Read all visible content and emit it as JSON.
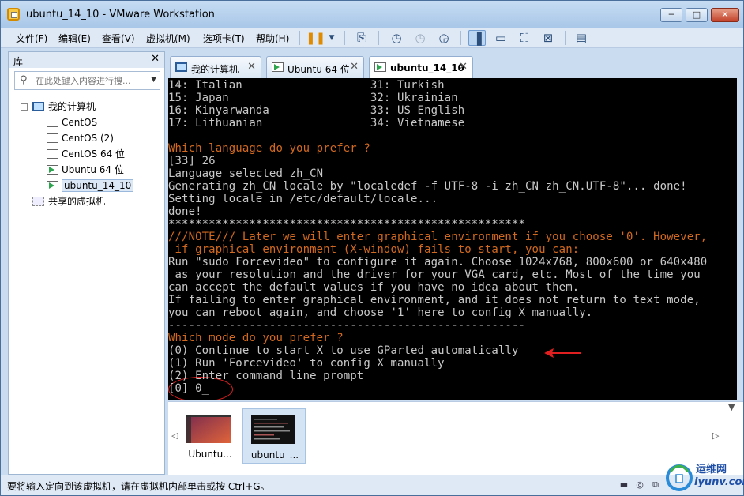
{
  "window": {
    "title": "ubuntu_14_10 - VMware Workstation",
    "controls": {
      "minimize": "─",
      "maximize": "□",
      "close": "✕"
    }
  },
  "menu": [
    "文件(F)",
    "编辑(E)",
    "查看(V)",
    "虚拟机(M)",
    "选项卡(T)",
    "帮助(H)"
  ],
  "library": {
    "title": "库",
    "search_placeholder": "在此处键入内容进行搜...",
    "my_computer": "我的计算机",
    "vms": [
      "CentOS",
      "CentOS (2)",
      "CentOS 64 位",
      "Ubuntu 64 位",
      "ubuntu_14_10"
    ],
    "shared": "共享的虚拟机"
  },
  "tabs": [
    {
      "label": "我的计算机"
    },
    {
      "label": "Ubuntu 64 位"
    },
    {
      "label": "ubuntu_14_10"
    }
  ],
  "console": {
    "lines": [
      {
        "text": "14: Italian                   31: Turkish",
        "color": "gray"
      },
      {
        "text": "15: Japan                     32: Ukrainian",
        "color": "gray"
      },
      {
        "text": "16: Kinyarwanda               33: US English",
        "color": "gray"
      },
      {
        "text": "17: Lithuanian                34: Vietnamese",
        "color": "gray"
      },
      {
        "text": "",
        "color": "gray"
      },
      {
        "text": "Which language do you prefer ?",
        "color": "orange"
      },
      {
        "text": "[33] 26",
        "color": "gray"
      },
      {
        "text": "Language selected zh_CN",
        "color": "gray"
      },
      {
        "text": "Generating zh_CN locale by \"localedef -f UTF-8 -i zh_CN zh_CN.UTF-8\"... done!",
        "color": "gray"
      },
      {
        "text": "Setting locale in /etc/default/locale...",
        "color": "gray"
      },
      {
        "text": "done!",
        "color": "gray"
      },
      {
        "text": "*****************************************************",
        "color": "gray"
      },
      {
        "text": "///NOTE/// Later we will enter graphical environment if you choose '0'. However,",
        "color": "orange"
      },
      {
        "text": " if graphical environment (X-window) fails to start, you can:",
        "color": "orange"
      },
      {
        "text": "Run \"sudo Forcevideo\" to configure it again. Choose 1024x768, 800x600 or 640x480",
        "color": "gray"
      },
      {
        "text": " as your resolution and the driver for your VGA card, etc. Most of the time you",
        "color": "gray"
      },
      {
        "text": "can accept the default values if you have no idea about them.",
        "color": "gray"
      },
      {
        "text": "If failing to enter graphical environment, and it does not return to text mode,",
        "color": "gray"
      },
      {
        "text": "you can reboot again, and choose '1' here to config X manually.",
        "color": "gray"
      },
      {
        "text": "-----------------------------------------------------",
        "color": "gray"
      },
      {
        "text": "Which mode do you prefer ?",
        "color": "orange"
      },
      {
        "text": "(0) Continue to start X to use GParted automatically",
        "color": "gray"
      },
      {
        "text": "(1) Run 'Forcevideo' to config X manually",
        "color": "gray"
      },
      {
        "text": "(2) Enter command line prompt",
        "color": "gray"
      },
      {
        "text": "[0] 0_",
        "color": "gray"
      }
    ]
  },
  "thumbnails": [
    {
      "label": "Ubuntu..."
    },
    {
      "label": "ubuntu_..."
    }
  ],
  "status": {
    "text": "要将输入定向到该虚拟机，请在虚拟机内部单击或按 Ctrl+G。"
  },
  "watermark": {
    "line1": "运维网",
    "line2": "iyunv.com"
  }
}
